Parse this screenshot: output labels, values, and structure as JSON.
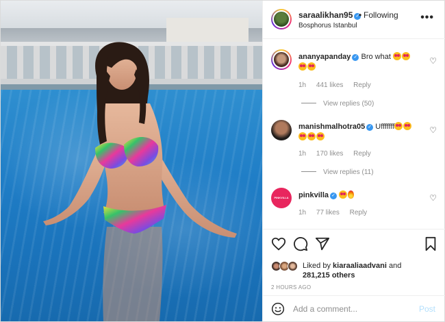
{
  "header": {
    "username": "saraalikhan95",
    "separator": "•",
    "follow_label": "Following",
    "location": "Bosphorus Istanbul",
    "more_label": "•••"
  },
  "comments": [
    {
      "username": "ananyapanday",
      "text": "Bro what",
      "time": "1h",
      "likes": "441 likes",
      "reply_label": "Reply",
      "view_replies": "View replies (50)"
    },
    {
      "username": "manishmalhotra05",
      "text": "Ufffffff",
      "time": "1h",
      "likes": "170 likes",
      "reply_label": "Reply",
      "view_replies": "View replies (11)"
    },
    {
      "username": "pinkvilla",
      "avatar_text": "PINKVILLA",
      "text": "",
      "time": "1h",
      "likes": "77 likes",
      "reply_label": "Reply"
    }
  ],
  "likes": {
    "prefix": "Liked by",
    "user": "kiaraaliaadvani",
    "connector": "and",
    "others": "281,215 others"
  },
  "timestamp": "2 HOURS AGO",
  "add_comment": {
    "placeholder": "Add a comment...",
    "post_label": "Post"
  },
  "colors": {
    "verified": "#3897f0",
    "pinkvilla": "#e8265e",
    "post_disabled": "#b2dffc"
  },
  "icons": [
    "heart-icon",
    "comment-icon",
    "share-icon",
    "bookmark-icon",
    "smile-icon",
    "more-icon"
  ]
}
